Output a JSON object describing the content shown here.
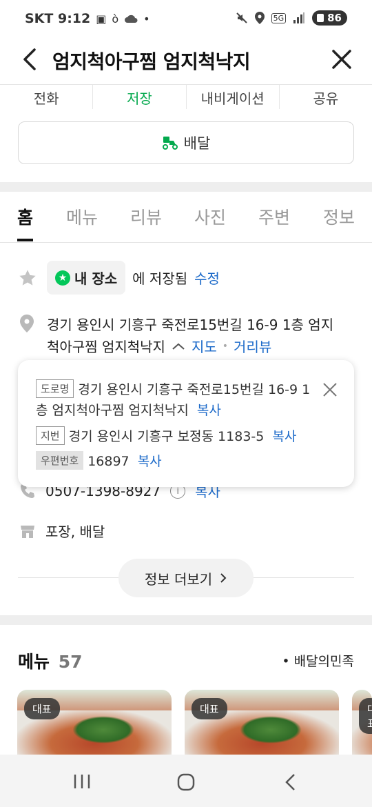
{
  "status_bar": {
    "carrier_time": "SKT 9:12",
    "network": "5G",
    "battery": "86"
  },
  "app_bar": {
    "title": "엄지척아구찜 엄지척낙지"
  },
  "actions": [
    "전화",
    "저장",
    "내비게이션",
    "공유"
  ],
  "delivery_button": "배달",
  "tabs": [
    "홈",
    "메뉴",
    "리뷰",
    "사진",
    "주변",
    "정보"
  ],
  "saved": {
    "place_label": "내 장소",
    "suffix": "에 저장됨",
    "edit": "수정"
  },
  "address": {
    "line1": "경기 용인시 기흥구 죽전로15번길 16-9 1층 엄지",
    "line2": "척아구찜 엄지척낙지",
    "map_link": "지도",
    "bullet": "•",
    "street_view_link": "거리뷰"
  },
  "address_popup": {
    "road_tag": "도로명",
    "road_line1": "경기 용인시 기흥구 죽전로15번길 16-9 1",
    "road_line2": "층 엄지척아구찜 엄지척낙지",
    "jibun_tag": "지번",
    "jibun": "경기 용인시 기흥구 보정동 1183-5",
    "postal_tag": "우편번호",
    "postal": "16897",
    "copy": "복사"
  },
  "phone": {
    "number": "0507-1398-8927",
    "info_icon": "i",
    "copy": "복사"
  },
  "service": "포장, 배달",
  "more_info": "정보 더보기",
  "menu_section": {
    "title": "메뉴",
    "count": "57",
    "source": "배달의민족",
    "card_badge": "대표"
  },
  "colors": {
    "accent_green": "#03c75a",
    "link_blue": "#1c6ac9"
  }
}
